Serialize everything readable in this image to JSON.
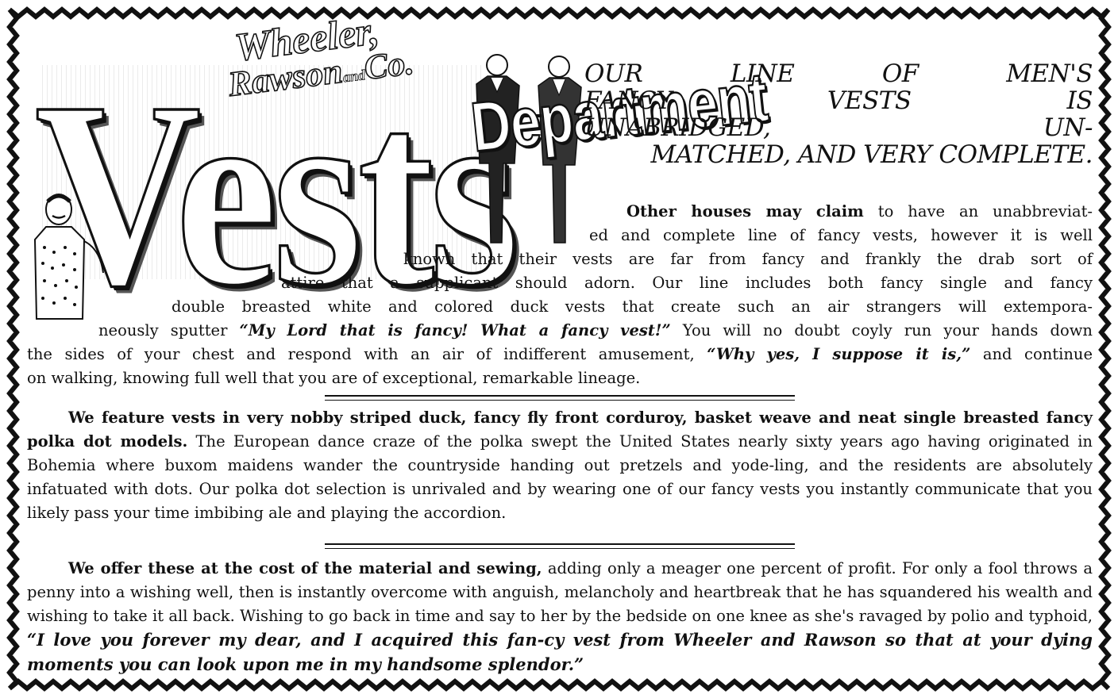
{
  "header": {
    "company_line1": "Wheeler,",
    "company_line2": "Rawson",
    "company_and": "and",
    "company_line3": "Co.",
    "title_big": "Vests",
    "title_department": "Department"
  },
  "headline": {
    "line1": "Our line of men's",
    "line2": "fancy vests is",
    "line3": "unabridged, un-",
    "line4": "matched, and very complete."
  },
  "paragraph1": {
    "lead": "Other houses may claim",
    "l1_rest": " to have an unabbreviat-",
    "l2": "ed and complete line of fancy vests, however it is well",
    "l3": "known that their vests are far from fancy and frankly the drab sort of",
    "l4": "attire that a supplicant should adorn.  Our line includes both fancy single and fancy",
    "l5": "double breasted white and colored duck vests that create such an air strangers will extempora-",
    "l6_a": "neously sputter ",
    "l6_quote": "“My Lord that is fancy!  What a fancy vest!”",
    "l6_b": " You will no doubt coyly run your hands down",
    "l7_a": "the sides of your chest and respond with an air of indifferent amusement, ",
    "l7_quote": "“Why yes, I suppose it is,”",
    "l7_b": " and continue",
    "l8": "on walking, knowing full well that you are of exceptional, remarkable lineage."
  },
  "paragraph2": {
    "lead": "We feature vests in very nobby striped duck, fancy fly front corduroy, basket weave and neat single breasted fancy polka dot models.",
    "body": "  The European dance craze of the polka swept the United States nearly sixty years ago having originated in Bohemia where buxom maidens wander the countryside handing out pretzels and yode-ling, and the residents are absolutely infatuated with dots.  Our polka dot selection is unrivaled and by wearing one of our fancy vests you instantly communicate that you likely pass your time imbibing ale and playing the accordion."
  },
  "paragraph3": {
    "lead": "We offer these at the cost of the material and sewing,",
    "body": " adding only a meager one percent of profit.  For only a fool throws a penny into a wishing well, then is instantly overcome with anguish, melancholy and heartbreak that he has squandered his wealth and wishing to take it all back.  Wishing to go back in time and say to her by the bedside on one knee as she's ravaged by polio and typhoid, ",
    "quote": "“I love you forever my dear, and I acquired this fan-cy vest from Wheeler and Rawson so that at your dying moments you can look upon me in my handsome splendor.”"
  }
}
